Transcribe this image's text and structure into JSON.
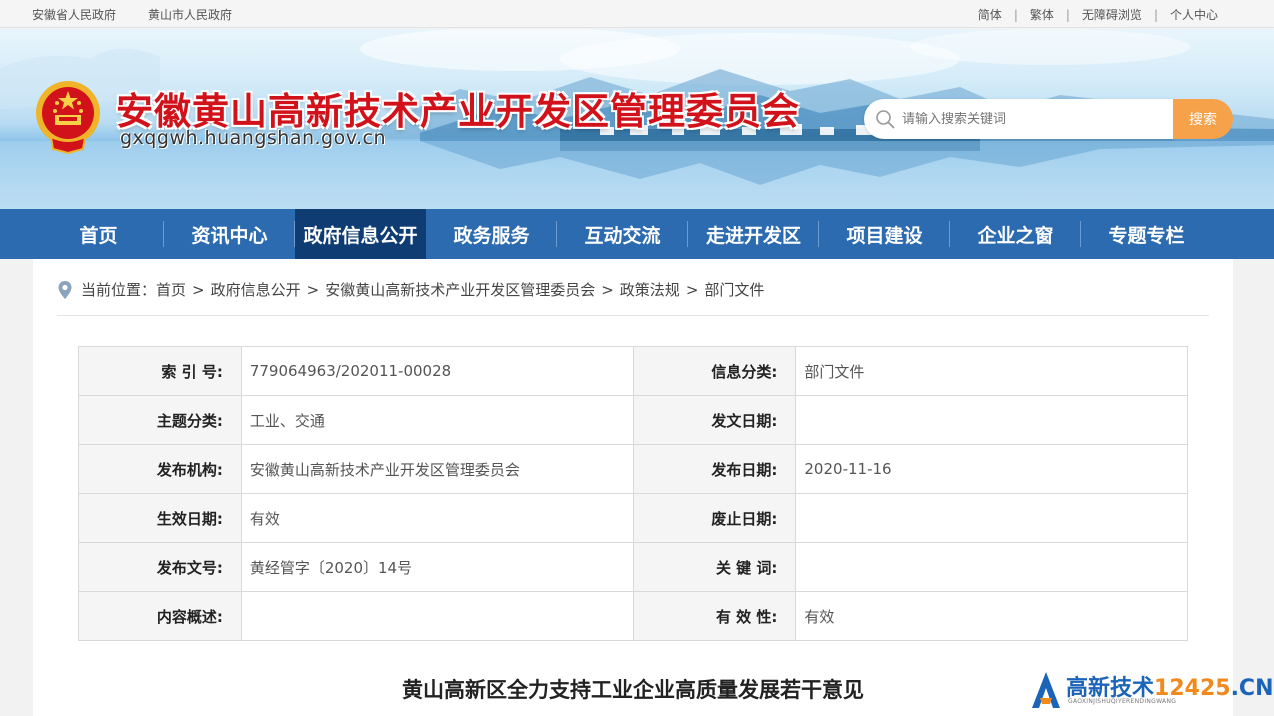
{
  "topbar": {
    "left_links": [
      "安徽省人民政府",
      "黄山市人民政府"
    ],
    "right_links": [
      "简体",
      "繁体",
      "无障碍浏览",
      "个人中心"
    ],
    "separator": "|"
  },
  "header": {
    "site_title": "安徽黄山高新技术产业开发区管理委员会",
    "site_domain": "gxqgwh.huangshan.gov.cn",
    "search_placeholder": "请输入搜索关键词",
    "search_button": "搜索",
    "emblem_icon": "national-emblem-icon",
    "accent_color": "#d2121a",
    "search_button_color": "#f5a24b"
  },
  "nav": {
    "items": [
      "首页",
      "资讯中心",
      "政府信息公开",
      "政务服务",
      "互动交流",
      "走进开发区",
      "项目建设",
      "企业之窗",
      "专题专栏"
    ],
    "active": "政府信息公开",
    "bar_color": "#2c6bb0",
    "active_color": "#0f3d73"
  },
  "breadcrumb": {
    "prefix": "当前位置：",
    "items": [
      "首页",
      "政府信息公开",
      "安徽黄山高新技术产业开发区管理委员会",
      "政策法规",
      "部门文件"
    ],
    "separator": ">",
    "icon": "location-pin-icon"
  },
  "meta_table": {
    "rows": [
      [
        {
          "label": "索 引 号:",
          "value": "779064963/202011-00028"
        },
        {
          "label": "信息分类:",
          "value": "部门文件"
        }
      ],
      [
        {
          "label": "主题分类:",
          "value": "工业、交通"
        },
        {
          "label": "发文日期:",
          "value": ""
        }
      ],
      [
        {
          "label": "发布机构:",
          "value": "安徽黄山高新技术产业开发区管理委员会"
        },
        {
          "label": "发布日期:",
          "value": "2020-11-16"
        }
      ],
      [
        {
          "label": "生效日期:",
          "value": "有效"
        },
        {
          "label": "废止日期:",
          "value": ""
        }
      ],
      [
        {
          "label": "发布文号:",
          "value": "黄经管字〔2020〕14号"
        },
        {
          "label": "关 键 词:",
          "value": ""
        }
      ],
      [
        {
          "label": "内容概述:",
          "value": ""
        },
        {
          "label": "有 效 性:",
          "value": "有效"
        }
      ]
    ]
  },
  "document": {
    "title": "黄山高新区全力支持工业企业高质量发展若干意见"
  },
  "watermark": {
    "text_main": "高新技术",
    "text_number": "12425",
    "text_suffix": ".CN",
    "subtitle": "GAOXINJISHUQIYERENDINGWANG"
  }
}
